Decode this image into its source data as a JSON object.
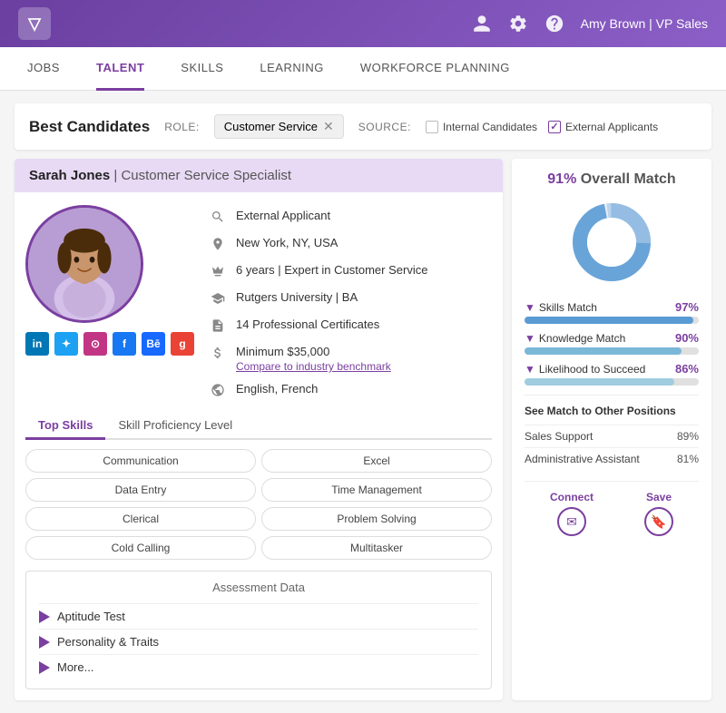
{
  "app": {
    "logo": "▽",
    "user": "Amy Brown | VP Sales",
    "nav": [
      "JOBS",
      "TALENT",
      "SKILLS",
      "LEARNING",
      "WORKFORCE PLANNING"
    ],
    "active_nav": "TALENT"
  },
  "header": {
    "title": "Best Candidates",
    "role_label": "ROLE:",
    "role_value": "Customer Service",
    "source_label": "SOURCE:",
    "source_internal": "Internal Candidates",
    "source_external": "External Applicants"
  },
  "candidate": {
    "name": "Sarah Jones",
    "title": "Customer Service Specialist",
    "details": [
      {
        "icon": "search",
        "text": "External Applicant"
      },
      {
        "icon": "location",
        "text": "New York, NY, USA"
      },
      {
        "icon": "crown",
        "text": "6 years | Expert in Customer Service"
      },
      {
        "icon": "graduation",
        "text": "Rutgers University | BA"
      },
      {
        "icon": "certificate",
        "text": "14 Professional Certificates"
      },
      {
        "icon": "dollar",
        "text": "Minimum $35,000",
        "sub": "Compare to industry benchmark"
      },
      {
        "icon": "globe",
        "text": "English, French"
      }
    ],
    "social": [
      "in",
      "tw",
      "ig",
      "fb",
      "bē",
      "g"
    ],
    "skills_tabs": [
      "Top Skills",
      "Skill Proficiency Level"
    ],
    "skills": [
      "Communication",
      "Excel",
      "Data Entry",
      "Time Management",
      "Clerical",
      "Problem Solving",
      "Cold Calling",
      "Multitasker"
    ],
    "assessment": {
      "title": "Assessment Data",
      "items": [
        "Aptitude Test",
        "Personality & Traits",
        "More..."
      ]
    }
  },
  "match": {
    "overall_pct": "91%",
    "overall_label": "Overall Match",
    "bars": [
      {
        "label": "Skills Match",
        "pct": 97,
        "display": "97%"
      },
      {
        "label": "Knowledge Match",
        "pct": 90,
        "display": "90%"
      },
      {
        "label": "Likelihood to Succeed",
        "pct": 86,
        "display": "86%"
      }
    ],
    "other_positions_title": "See Match to Other Positions",
    "positions": [
      {
        "name": "Sales Support",
        "pct": "89%"
      },
      {
        "name": "Administrative Assistant",
        "pct": "81%"
      }
    ],
    "connect_label": "Connect",
    "save_label": "Save"
  }
}
